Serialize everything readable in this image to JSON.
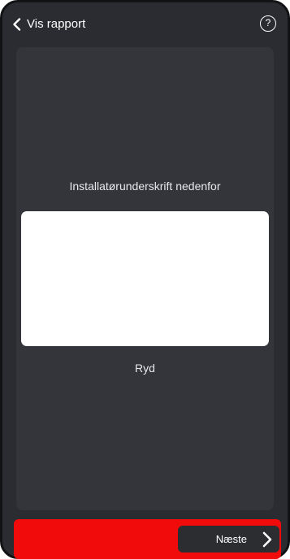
{
  "header": {
    "back_label": "Vis rapport",
    "help_label": "?"
  },
  "signature": {
    "prompt": "Installatørunderskrift nedenfor",
    "clear_label": "Ryd"
  },
  "footer": {
    "next_label": "Næste"
  },
  "colors": {
    "background": "#2a2c32",
    "panel": "#33353b",
    "footer_bar": "#f20b0b",
    "next_button": "#2b2d31",
    "text": "#ffffff"
  }
}
